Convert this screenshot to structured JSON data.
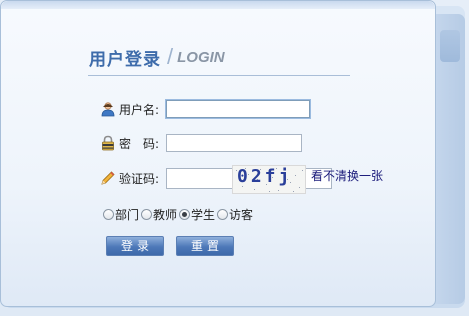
{
  "form": {
    "title_cn": "用户登录",
    "title_sep": "/",
    "title_en": "LOGIN",
    "username_label": "用户名:",
    "username_value": "",
    "password_label": "密　码:",
    "password_value": "",
    "captcha_label": "验证码:",
    "captcha_value": "",
    "captcha_image_text": "02fj",
    "refresh_label": "看不清换一张",
    "roles": [
      {
        "label": "部门",
        "checked": false
      },
      {
        "label": "教师",
        "checked": false
      },
      {
        "label": "学生",
        "checked": true
      },
      {
        "label": "访客",
        "checked": false
      }
    ],
    "login_button": "登录",
    "reset_button": "重置"
  },
  "colors": {
    "accent": "#3e6cab",
    "button": "#4d78b8",
    "link": "#1a1a7a"
  },
  "icons": {
    "username": "user-icon",
    "password": "lock-icon",
    "captcha": "pencil-icon"
  }
}
